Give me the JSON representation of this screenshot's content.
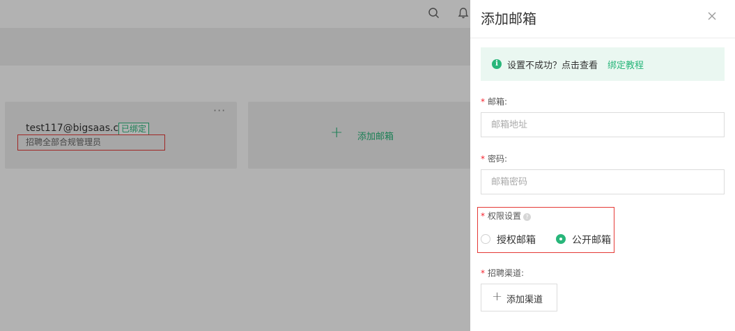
{
  "background": {
    "card": {
      "email": "test117@bigsaas.cn",
      "badge": "已绑定",
      "role": "招聘全部合规管理员",
      "more": "···"
    },
    "add_card": {
      "plus": "+",
      "label": "添加邮箱"
    }
  },
  "drawer": {
    "title": "添加邮箱",
    "close_icon": "close-icon",
    "tip": {
      "icon": "info-icon",
      "text": "设置不成功？点击查看",
      "link": "绑定教程"
    },
    "email": {
      "label": "邮箱:",
      "placeholder": "邮箱地址",
      "value": ""
    },
    "password": {
      "label": "密码:",
      "placeholder": "邮箱密码",
      "value": ""
    },
    "permission": {
      "label": "权限设置",
      "options": [
        {
          "label": "授权邮箱",
          "checked": false
        },
        {
          "label": "公开邮箱",
          "checked": true
        }
      ]
    },
    "channel": {
      "label": "招聘渠道:",
      "button_plus": "+",
      "button_label": "添加渠道"
    }
  },
  "colors": {
    "accent": "#28b67a",
    "required_star": "#f5222d",
    "highlight_box": "#e53935"
  }
}
